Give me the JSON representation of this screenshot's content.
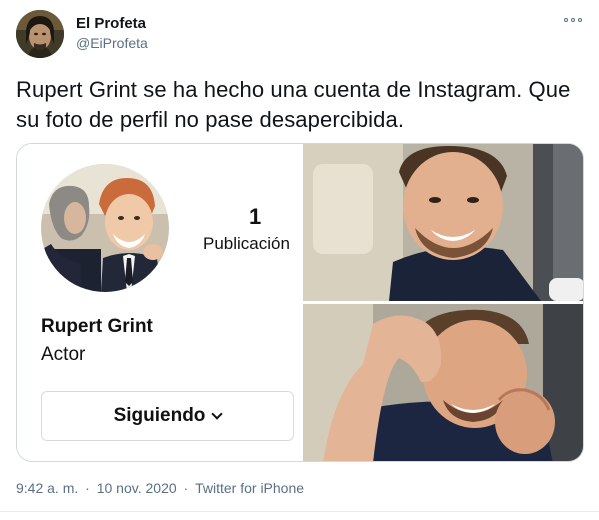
{
  "author": {
    "name": "El Profeta",
    "handle": "@EiProfeta",
    "avatar_icon": "profile-avatar"
  },
  "tweet": {
    "text": "Rupert Grint se ha hecho una cuenta de Instagram. Que su foto de perfil no pase desapercibida."
  },
  "instagram_card": {
    "posts_count": "1",
    "posts_label": "Publicación",
    "display_name": "Rupert Grint",
    "bio": "Actor",
    "follow_button": "Siguiendo"
  },
  "meta": {
    "time": "9:42 a. m.",
    "date": "10 nov. 2020",
    "source": "Twitter for iPhone"
  },
  "colors": {
    "text_primary": "#0f1419",
    "text_secondary": "#5b7083",
    "border": "#cfd9de"
  }
}
